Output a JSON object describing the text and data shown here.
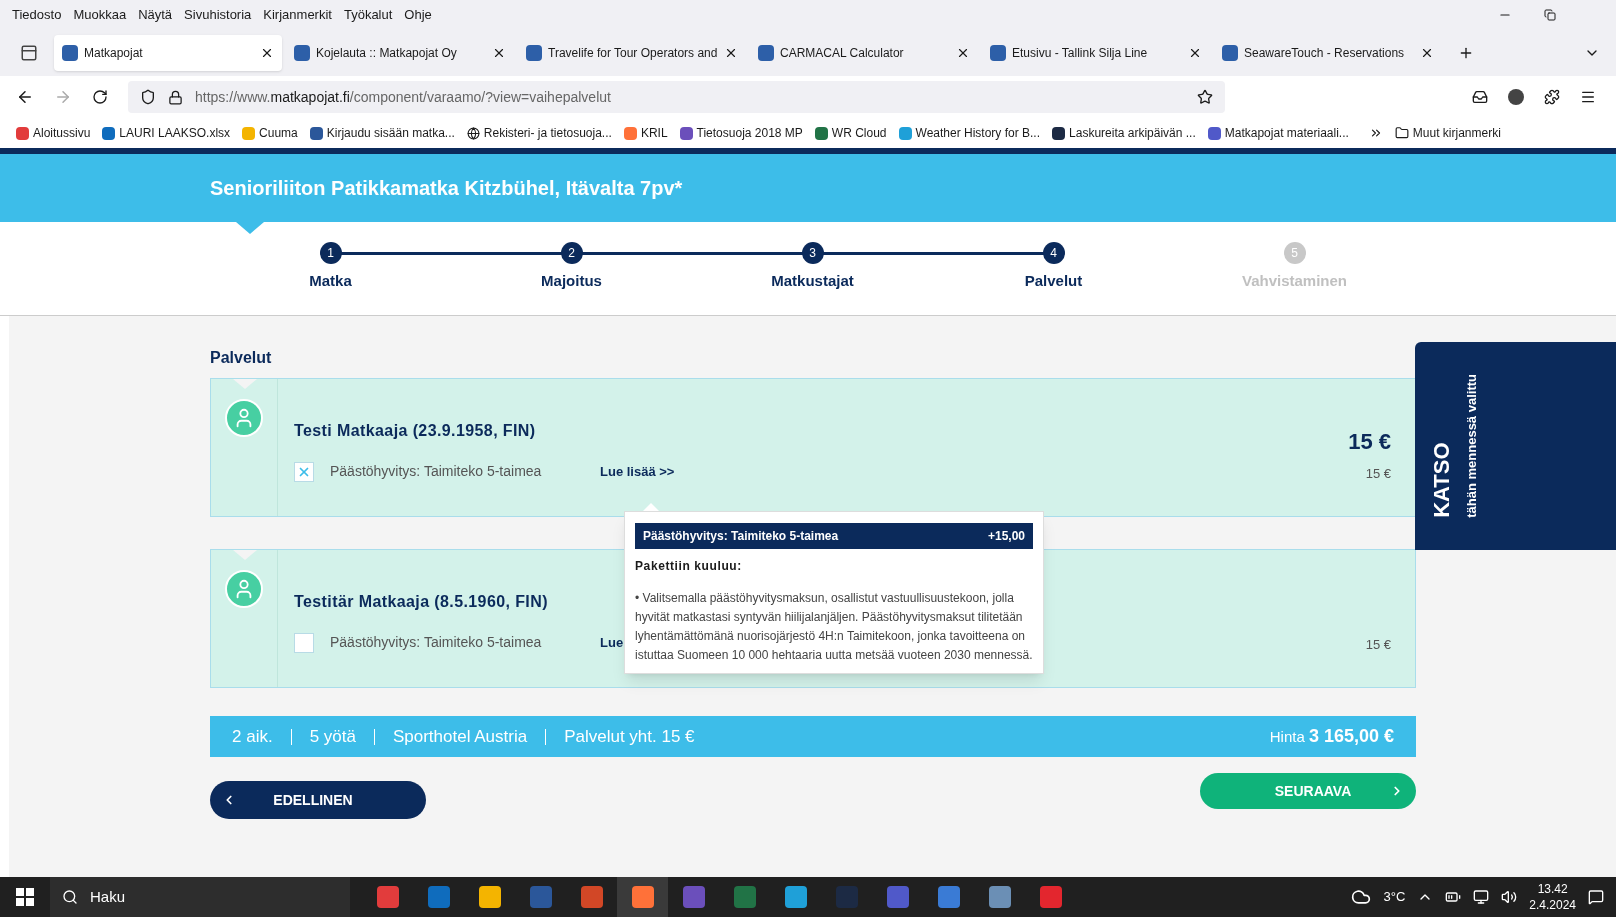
{
  "menu_bar": [
    "Tiedosto",
    "Muokkaa",
    "Näytä",
    "Sivuhistoria",
    "Kirjanmerkit",
    "Työkalut",
    "Ohje"
  ],
  "tabs": [
    {
      "title": "Matkapojat",
      "selected": true
    },
    {
      "title": "Kojelauta :: Matkapojat Oy",
      "selected": false
    },
    {
      "title": "Travelife for Tour Operators and",
      "selected": false
    },
    {
      "title": "CARMACAL Calculator",
      "selected": false
    },
    {
      "title": "Etusivu - Tallink Silja Line",
      "selected": false
    },
    {
      "title": "SeawareTouch - Reservations",
      "selected": false
    }
  ],
  "address_bar": {
    "prefix": "https://www.",
    "domain": "matkapojat.fi",
    "path": "/component/varaamo/?view=vaihepalvelut"
  },
  "bookmarks": [
    "Aloitussivu",
    "LAURI LAAKSO.xlsx",
    "Cuuma",
    "Kirjaudu sisään matka...",
    "Rekisteri- ja tietosuoja...",
    "KRIL",
    "Tietosuoja 2018 MP",
    "WR Cloud",
    "Weather History for B...",
    "Laskureita arkipäivän ...",
    "Matkapojat materiaali..."
  ],
  "other_bookmarks": "Muut kirjanmerki",
  "page": {
    "title": "Senioriliiton Patikkamatka Kitzbühel, Itävalta 7pv*",
    "steps": [
      {
        "number": "1",
        "label": "Matka",
        "disabled": false
      },
      {
        "number": "2",
        "label": "Majoitus",
        "disabled": false
      },
      {
        "number": "3",
        "label": "Matkustajat",
        "disabled": false
      },
      {
        "number": "4",
        "label": "Palvelut",
        "disabled": false
      },
      {
        "number": "5",
        "label": "Vahvistaminen",
        "disabled": true
      }
    ],
    "section_title": "Palvelut",
    "travellers": [
      {
        "name": "Testi Matkaaja (23.9.1958, FIN)",
        "service": "Päästöhyvitys: Taimiteko 5-taimea",
        "checked": true,
        "link": "Lue lisää >>",
        "total": "15 €",
        "price": "15 €"
      },
      {
        "name": "Testitär Matkaaja (8.5.1960, FIN)",
        "service": "Päästöhyvitys: Taimiteko 5-taimea",
        "checked": false,
        "link": "Lue",
        "price": "15 €"
      }
    ],
    "tooltip": {
      "title": "Päästöhyvitys: Taimiteko 5-taimea",
      "price": "+15,00",
      "heading": "Pakettiin kuuluu:",
      "text": "• Valitsemalla päästöhyvitysmaksun, osallistut vastuullisuustekoon, jolla hyvität matkastasi syntyvän hiilijalanjäljen. Päästöhyvitysmaksut tilitetään lyhentämättömänä nuorisojärjestö 4H:n Taimitekoon, jonka tavoitteena on istuttaa Suomeen 10 000 hehtaaria uutta metsää vuoteen 2030 mennessä."
    },
    "summary": {
      "items": [
        "2 aik.",
        "5 yötä",
        "Sporthotel Austria",
        "Palvelut yht. 15 €"
      ],
      "total": "Hinta **3 165,00 €**"
    },
    "prev_button": "EDELLINEN",
    "next_button": "SEURAAVA",
    "side_tab": {
      "title": "KATSO",
      "subtitle": "tähän mennessä valittu"
    }
  },
  "taskbar": {
    "search": "Haku",
    "temperature": "3°C",
    "time": "13.42",
    "date": "2.4.2024"
  }
}
